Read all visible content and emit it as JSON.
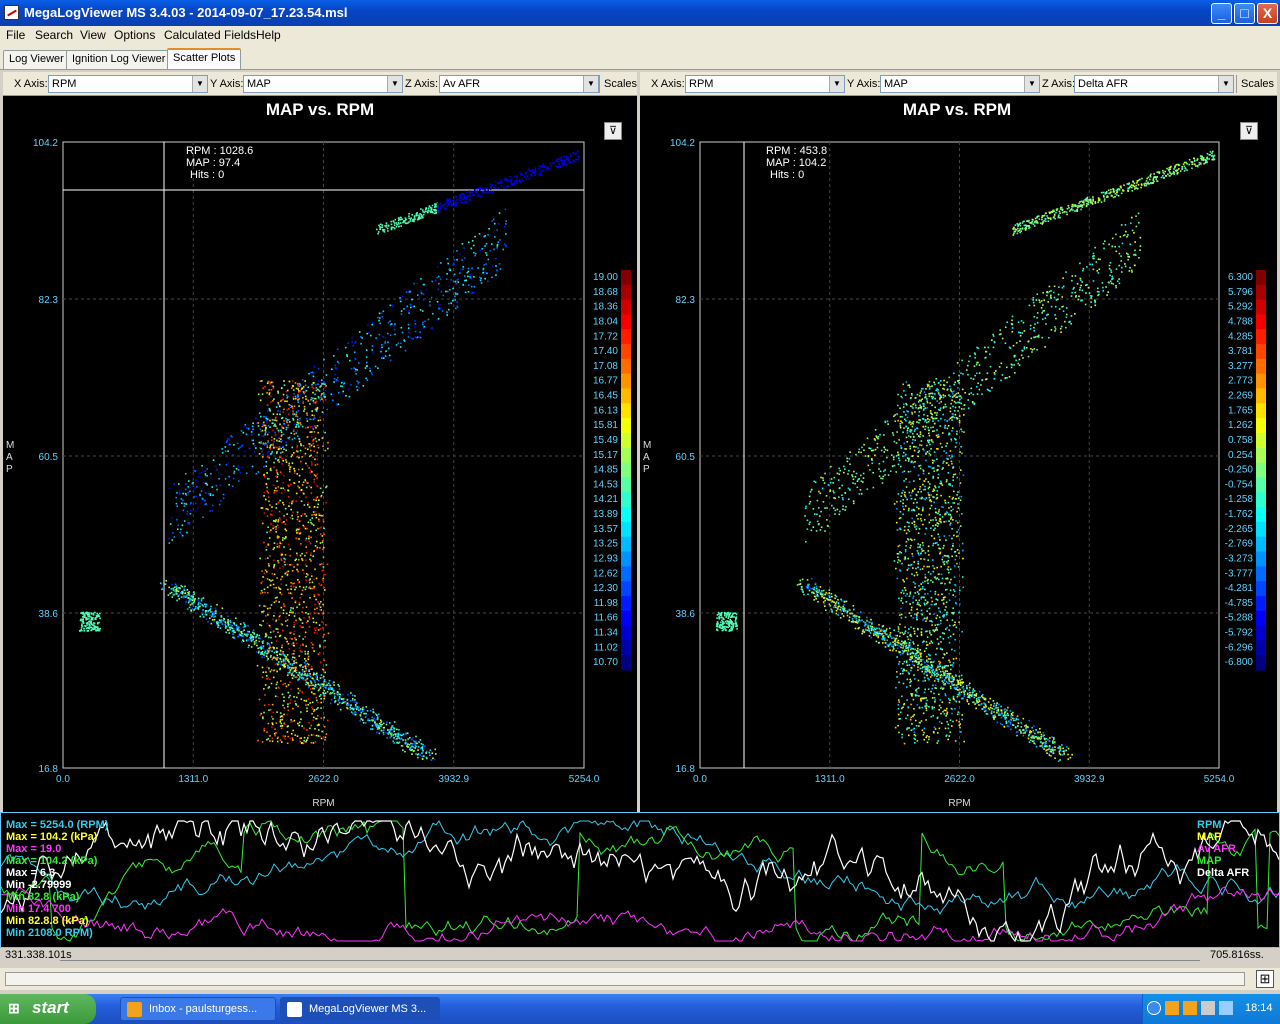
{
  "window": {
    "title": "MegaLogViewer MS 3.4.03 - 2014-09-07_17.23.54.msl",
    "min": "_",
    "max": "□",
    "close": "X"
  },
  "menu": [
    "File",
    "Search",
    "View",
    "Options",
    "Calculated Fields",
    "Help"
  ],
  "tabs": [
    "Log Viewer",
    "Ignition Log Viewer",
    "Scatter Plots"
  ],
  "left": {
    "x_label": "X Axis:",
    "x_value": "RPM",
    "y_label": "Y Axis:",
    "y_value": "MAP",
    "z_label": "Z Axis:",
    "z_value": "Av AFR",
    "scales": "Scales",
    "title": "MAP vs. RPM",
    "cursor": [
      "RPM : 1028.6",
      "MAP : 97.4",
      "Hits : 0"
    ],
    "y_ticks": [
      "104.2",
      "82.3",
      "60.5",
      "38.6",
      "16.8"
    ],
    "x_ticks": [
      "0.0",
      "1311.0",
      "2622.0",
      "3932.9",
      "5254.0"
    ],
    "ylabel": "MAP",
    "xlabel": "RPM",
    "scale": [
      "19.00",
      "18.68",
      "18.36",
      "18.04",
      "17.72",
      "17.40",
      "17.08",
      "16.77",
      "16.45",
      "16.13",
      "15.81",
      "15.49",
      "15.17",
      "14.85",
      "14.53",
      "14.21",
      "13.89",
      "13.57",
      "13.25",
      "12.93",
      "12.62",
      "12.30",
      "11.98",
      "11.66",
      "11.34",
      "11.02",
      "10.70"
    ]
  },
  "right": {
    "x_label": "X Axis:",
    "x_value": "RPM",
    "y_label": "Y Axis:",
    "y_value": "MAP",
    "z_label": "Z Axis:",
    "z_value": "Delta AFR",
    "scales": "Scales",
    "title": "MAP vs. RPM",
    "cursor": [
      "RPM : 453.8",
      "MAP : 104.2",
      "Hits : 0"
    ],
    "y_ticks": [
      "104.2",
      "82.3",
      "60.5",
      "38.6",
      "16.8"
    ],
    "x_ticks": [
      "0.0",
      "1311.0",
      "2622.0",
      "3932.9",
      "5254.0"
    ],
    "ylabel": "MAP",
    "xlabel": "RPM",
    "scale": [
      "6.300",
      "5.796",
      "5.292",
      "4.788",
      "4.285",
      "3.781",
      "3.277",
      "2.773",
      "2.269",
      "1.765",
      "1.262",
      "0.758",
      "0.254",
      "-0.250",
      "-0.754",
      "-1.258",
      "-1.762",
      "-2.265",
      "-2.769",
      "-3.273",
      "-3.777",
      "-4.281",
      "-4.785",
      "-5.288",
      "-5.792",
      "-6.296",
      "-6.800"
    ]
  },
  "strip": {
    "left_labels": [
      {
        "text": "Max = 5254.0 (RPM)",
        "color": "#33ccee"
      },
      {
        "text": "Max = 104.2 (kPa)",
        "color": "#ffff33"
      },
      {
        "text": "Max = 19.0",
        "color": "#ff33ff"
      },
      {
        "text": "Max = 104.2 (kPa)",
        "color": "#33ee33"
      },
      {
        "text": "Max = 6.3",
        "color": "#ffffff"
      },
      {
        "text": "Min -2.79999",
        "color": "#ffffff"
      },
      {
        "text": "Min 82.8 (kPa)",
        "color": "#33ee33"
      },
      {
        "text": "Min 17.4 700",
        "color": "#ff33ff"
      },
      {
        "text": "Min 82.8.8 (kPa)",
        "color": "#ffff33"
      },
      {
        "text": "Min 2108.0 RPM)",
        "color": "#33ccee"
      }
    ],
    "right_labels": [
      {
        "text": "RPM",
        "color": "#33ccee"
      },
      {
        "text": "MAP",
        "color": "#ffff33"
      },
      {
        "text": "Av AFR",
        "color": "#ff33ff"
      },
      {
        "text": "MAP",
        "color": "#33ee33"
      },
      {
        "text": "Delta AFR",
        "color": "#ffffff"
      }
    ]
  },
  "time": {
    "start": "331.338.101s",
    "end": "705.816ss."
  },
  "taskbar": {
    "start": "start",
    "tasks": [
      "Inbox - paulsturgess...",
      "MegaLogViewer MS 3..."
    ],
    "clock": "18:14"
  }
}
